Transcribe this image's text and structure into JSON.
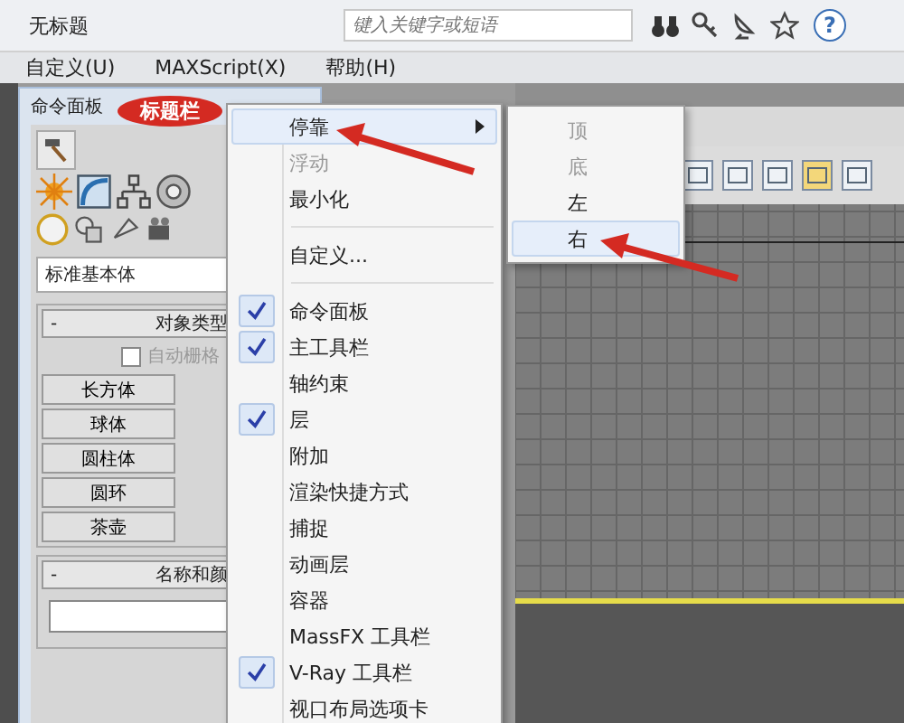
{
  "window": {
    "title": "无标题"
  },
  "search": {
    "placeholder": "键入关键字或短语"
  },
  "help": {
    "label": "?"
  },
  "menubar": [
    {
      "label": "自定义(U)"
    },
    {
      "label": "MAXScript(X)"
    },
    {
      "label": "帮助(H)"
    }
  ],
  "command_panel": {
    "title": "命令面板",
    "annotation": "标题栏",
    "dropdown": "标准基本体",
    "object_type": {
      "toggle": "-",
      "title": "对象类型",
      "autogrid": {
        "label": "自动栅格",
        "checked": false,
        "disabled": true
      },
      "buttons": [
        "长方体",
        "球体",
        "圆柱体",
        "圆环",
        "茶壶"
      ]
    },
    "name_color": {
      "toggle": "-",
      "title": "名称和颜"
    }
  },
  "context_menu": {
    "items": [
      {
        "kind": "item",
        "label": "停靠",
        "submenu": true,
        "selected": true,
        "disabled": false,
        "checked": false
      },
      {
        "kind": "item",
        "label": "浮动",
        "submenu": false,
        "selected": false,
        "disabled": true,
        "checked": false
      },
      {
        "kind": "item",
        "label": "最小化",
        "submenu": false,
        "selected": false,
        "disabled": false,
        "checked": false
      },
      {
        "kind": "separator"
      },
      {
        "kind": "item",
        "label": "自定义...",
        "submenu": false,
        "selected": false,
        "disabled": false,
        "checked": false
      },
      {
        "kind": "separator"
      },
      {
        "kind": "item",
        "label": "命令面板",
        "submenu": false,
        "selected": false,
        "disabled": false,
        "checked": true
      },
      {
        "kind": "item",
        "label": "主工具栏",
        "submenu": false,
        "selected": false,
        "disabled": false,
        "checked": true
      },
      {
        "kind": "item",
        "label": "轴约束",
        "submenu": false,
        "selected": false,
        "disabled": false,
        "checked": false
      },
      {
        "kind": "item",
        "label": "层",
        "submenu": false,
        "selected": false,
        "disabled": false,
        "checked": true
      },
      {
        "kind": "item",
        "label": "附加",
        "submenu": false,
        "selected": false,
        "disabled": false,
        "checked": false
      },
      {
        "kind": "item",
        "label": "渲染快捷方式",
        "submenu": false,
        "selected": false,
        "disabled": false,
        "checked": false
      },
      {
        "kind": "item",
        "label": "捕捉",
        "submenu": false,
        "selected": false,
        "disabled": false,
        "checked": false
      },
      {
        "kind": "item",
        "label": "动画层",
        "submenu": false,
        "selected": false,
        "disabled": false,
        "checked": false
      },
      {
        "kind": "item",
        "label": "容器",
        "submenu": false,
        "selected": false,
        "disabled": false,
        "checked": false
      },
      {
        "kind": "item",
        "label": "MassFX 工具栏",
        "submenu": false,
        "selected": false,
        "disabled": false,
        "checked": false
      },
      {
        "kind": "item",
        "label": "V-Ray 工具栏",
        "submenu": false,
        "selected": false,
        "disabled": false,
        "checked": true
      },
      {
        "kind": "item",
        "label": "视口布局选项卡",
        "submenu": false,
        "selected": false,
        "disabled": false,
        "checked": false
      }
    ]
  },
  "submenu": {
    "items": [
      {
        "label": "顶",
        "selected": false,
        "disabled": true
      },
      {
        "label": "底",
        "selected": false,
        "disabled": true
      },
      {
        "label": "左",
        "selected": false,
        "disabled": false
      },
      {
        "label": "右",
        "selected": true,
        "disabled": false
      }
    ]
  }
}
